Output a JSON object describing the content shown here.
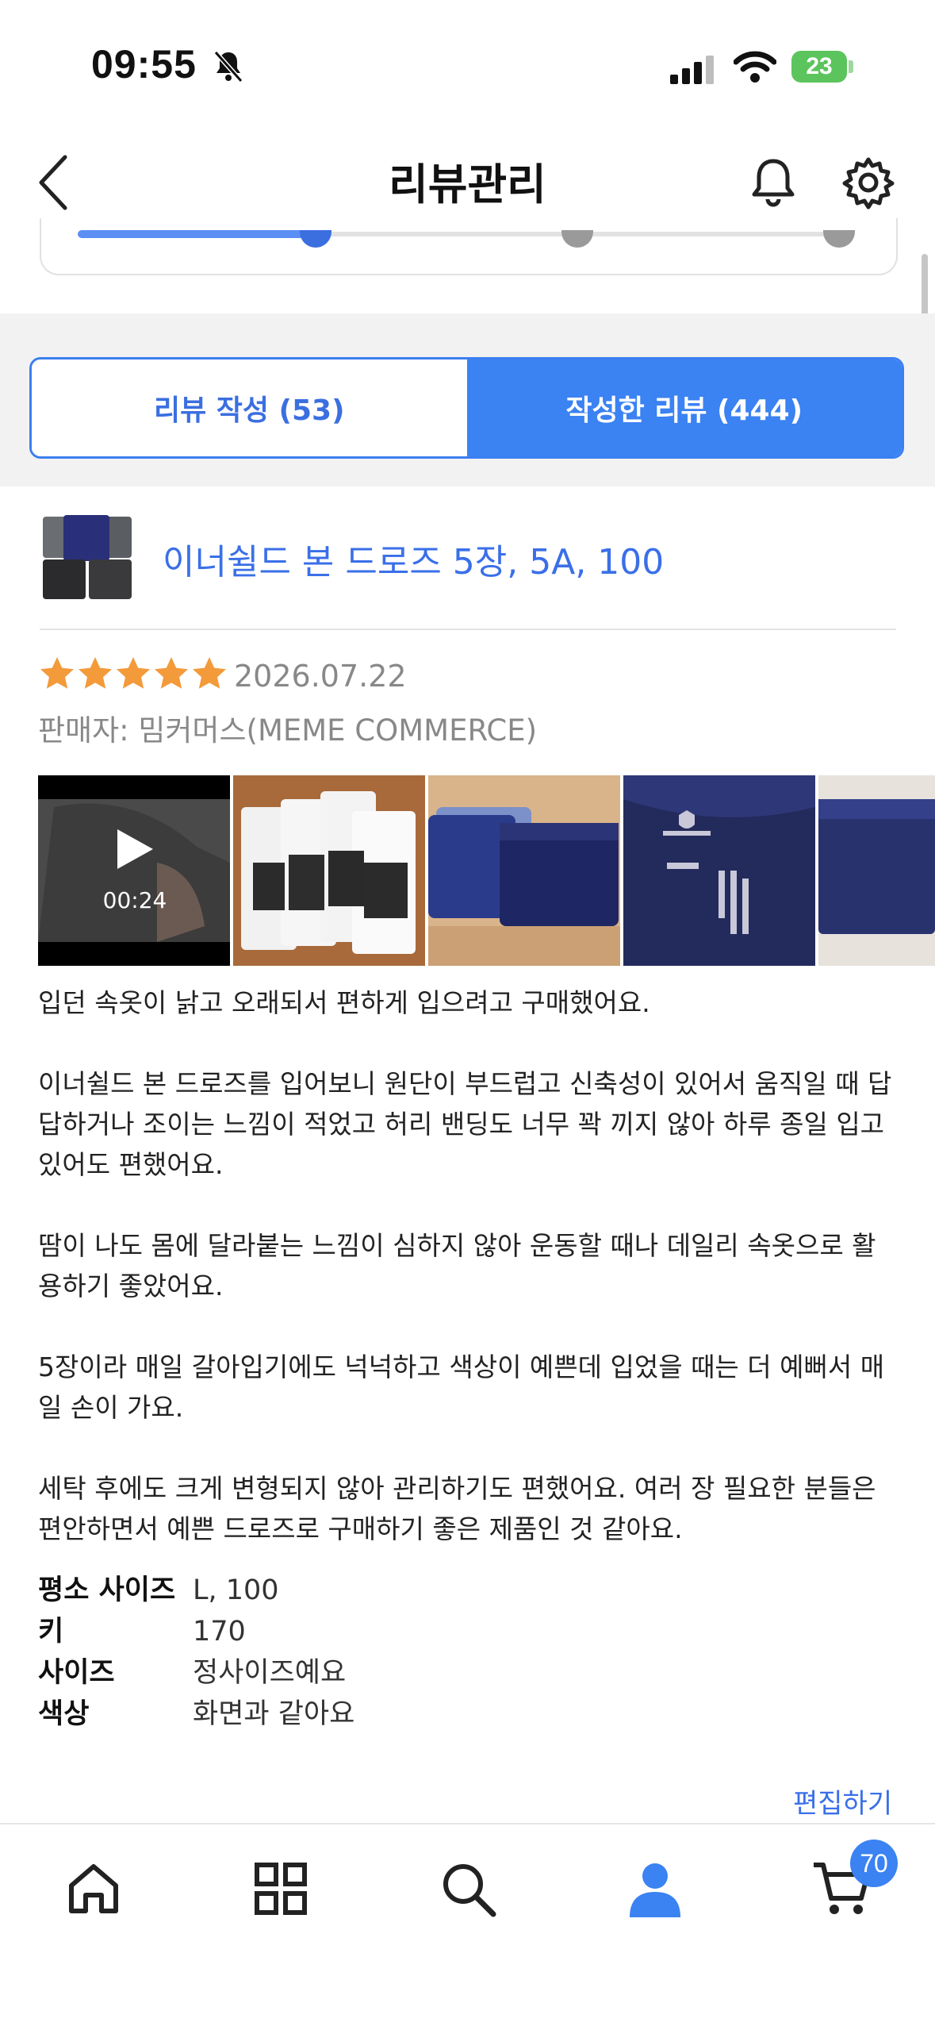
{
  "status_bar": {
    "time": "09:55",
    "battery": "23"
  },
  "header": {
    "title": "리뷰관리"
  },
  "tabs": [
    {
      "label": "리뷰 작성 (53)",
      "active": false
    },
    {
      "label": "작성한 리뷰 (444)",
      "active": true
    }
  ],
  "review": {
    "product_name": "이너쉴드 본 드로즈 5장, 5A, 100",
    "rating": 5,
    "date": "2026.07.22",
    "seller": "판매자: 밈커머스(MEME COMMERCE)",
    "video_duration": "00:24",
    "paragraphs": [
      "입던 속옷이 낡고 오래되서 편하게 입으려고 구매했어요.",
      "이너쉴드 본 드로즈를 입어보니 원단이 부드럽고 신축성이 있어서 움직일 때 답답하거나 조이는 느낌이 적었고 허리 밴딩도 너무 꽉 끼지 않아 하루 종일 입고 있어도 편했어요.",
      "땀이 나도 몸에 달라붙는 느낌이 심하지 않아 운동할 때나 데일리 속옷으로 활용하기 좋았어요.",
      "5장이라 매일 갈아입기에도 넉넉하고 색상이 예쁜데 입었을 때는 더 예뻐서 매일 손이 가요.",
      "세탁 후에도 크게 변형되지 않아 관리하기도 편했어요. 여러 장 필요한 분들은 편안하면서 예쁜 드로즈로 구매하기 좋은 제품인 것 같아요."
    ],
    "attributes": [
      {
        "label": "평소 사이즈",
        "value": "L, 100"
      },
      {
        "label": "키",
        "value": "170"
      },
      {
        "label": "사이즈",
        "value": "정사이즈예요"
      },
      {
        "label": "색상",
        "value": "화면과 같아요"
      }
    ],
    "edit_label": "편집하기"
  },
  "bottom_nav": {
    "items": [
      "home-icon",
      "category-grid-icon",
      "search-icon",
      "profile-icon",
      "cart-icon"
    ],
    "cart_count": "70"
  },
  "colors": {
    "accent": "#3b82f2",
    "link": "#3a6fe8",
    "star": "#f39a3a"
  }
}
